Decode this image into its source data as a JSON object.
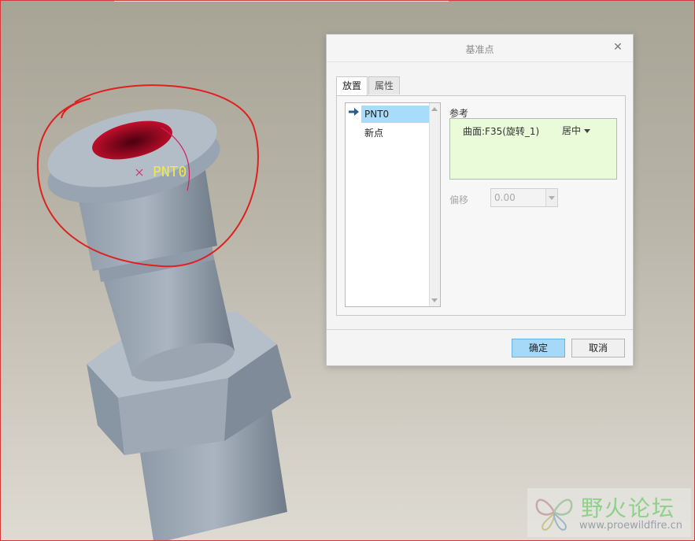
{
  "model_label": "PNT0",
  "dialog": {
    "title": "基准点",
    "close_icon": "✕",
    "tabs": [
      "放置",
      "属性"
    ],
    "point_list": [
      "PNT0",
      "新点"
    ],
    "references_label": "参考",
    "reference": {
      "surface": "曲面:F35(旋转_1)",
      "constraint": "居中"
    },
    "offset_label": "偏移",
    "offset_value": "0.00",
    "ok_label": "确定",
    "cancel_label": "取消"
  },
  "watermark": {
    "name": "野火论坛",
    "url": "www.proewildfire.cn"
  },
  "colors": {
    "annotation": "#e02020",
    "selection": "#a7dcfb",
    "reference_box": "#e9fbd9",
    "ok_button": "#a6d8f7"
  }
}
